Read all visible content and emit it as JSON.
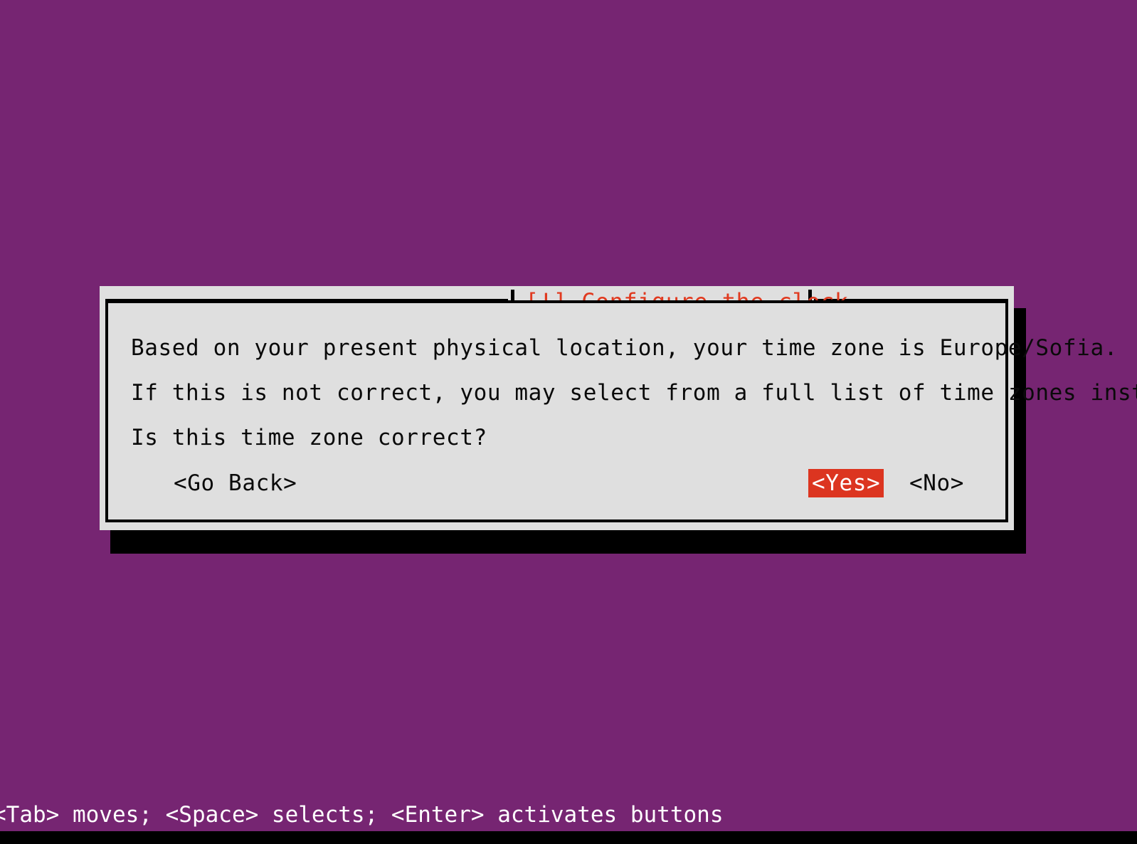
{
  "screen": {
    "background_color": "#762572",
    "accent_color": "#dc3520",
    "dialog_background_color": "#dfdfdf",
    "status_text": "<Tab> moves; <Space> selects; <Enter> activates buttons"
  },
  "dialog": {
    "title": "[!] Configure the clock",
    "lines": [
      "Based on your present physical location, your time zone is Europe/Sofia.",
      "If this is not correct, you may select from a full list of time zones instead.",
      "Is this time zone correct?"
    ],
    "buttons": {
      "go_back": "<Go Back>",
      "yes": "<Yes>",
      "no": "<No>"
    },
    "selected_button": "<Yes>"
  }
}
